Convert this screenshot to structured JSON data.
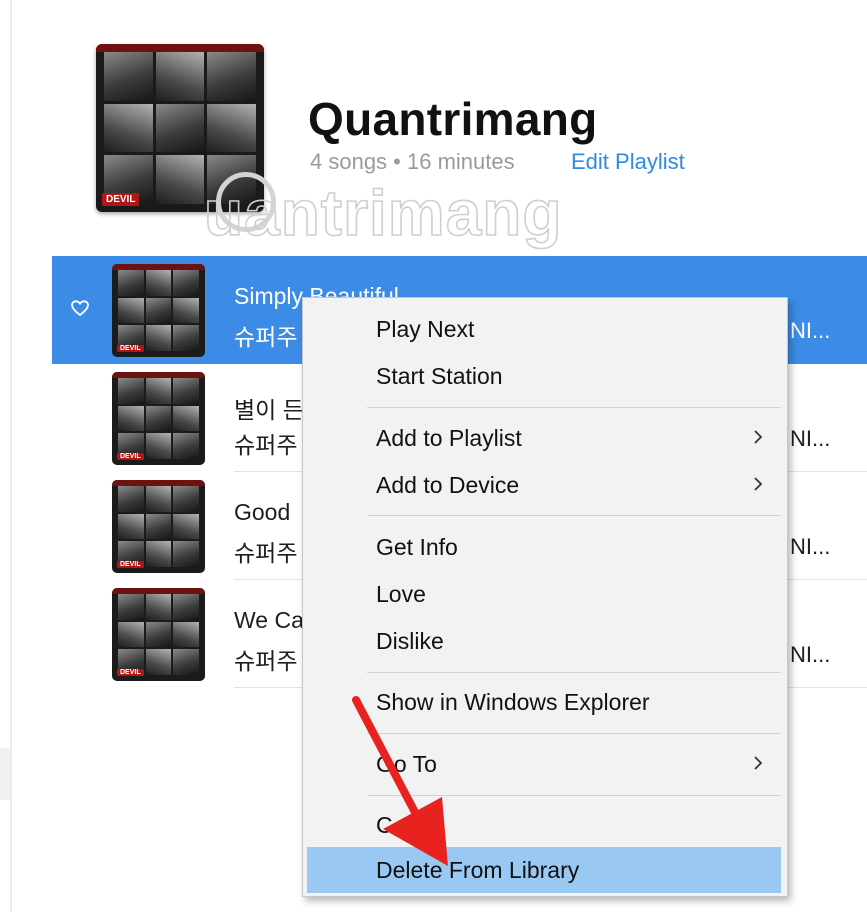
{
  "playlist": {
    "title": "Quantrimang",
    "meta": "4 songs • 16 minutes",
    "edit_label": "Edit Playlist"
  },
  "album_art": {
    "tag": "DEVIL",
    "icon": "album-art"
  },
  "watermark": "uantrimang",
  "songs": [
    {
      "title": "Simply Beautiful",
      "artist": "슈퍼주",
      "album": "NI...",
      "selected": true,
      "loved": false
    },
    {
      "title": "별이 든",
      "artist": "슈퍼주",
      "album": "NI...",
      "selected": false
    },
    {
      "title": "Good",
      "artist": "슈퍼주",
      "album": "NI...",
      "selected": false
    },
    {
      "title": "We Ca",
      "artist": "슈퍼주",
      "album": "NI...",
      "selected": false
    }
  ],
  "context_menu": {
    "items": [
      {
        "label": "Play Next"
      },
      {
        "label": "Start Station"
      },
      {
        "label": "Add to Playlist",
        "submenu": true
      },
      {
        "label": "Add to Device",
        "submenu": true
      },
      {
        "label": "Get Info"
      },
      {
        "label": "Love"
      },
      {
        "label": "Dislike"
      },
      {
        "label": "Show in Windows Explorer"
      },
      {
        "label": "Go To",
        "submenu": true
      },
      {
        "label": "C"
      },
      {
        "label": "Delete From Library",
        "highlighted": true
      }
    ]
  },
  "colors": {
    "selection": "#3c8ce7",
    "link": "#2e8ae6",
    "menu_highlight": "#99c9f2",
    "annotation_arrow": "#e8221f"
  }
}
